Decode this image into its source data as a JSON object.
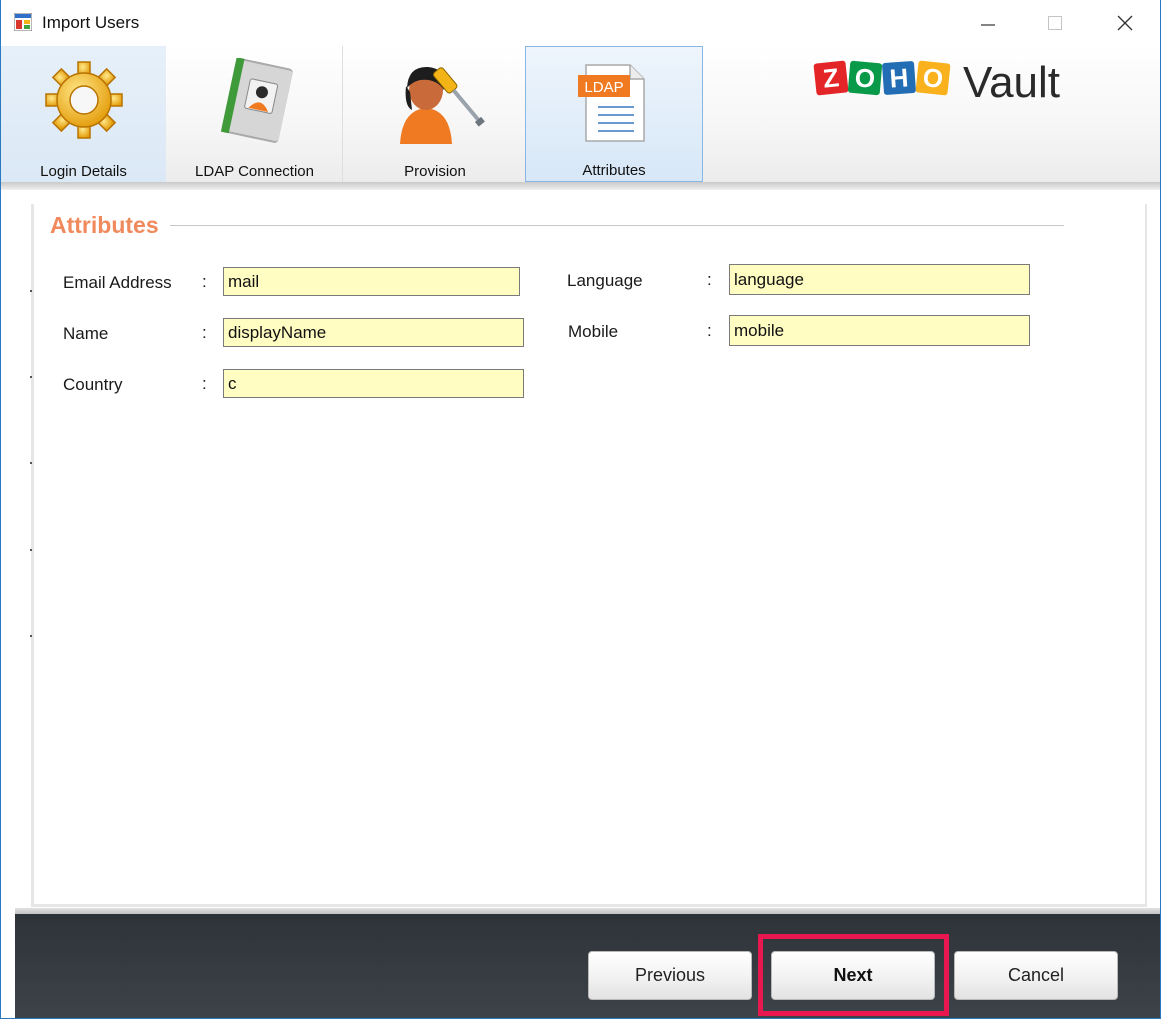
{
  "window": {
    "title": "Import Users",
    "icons": {
      "app": "app-window-icon",
      "minimize": "minimize-icon",
      "maximize": "maximize-icon",
      "close": "close-icon"
    }
  },
  "toolbar": {
    "tabs": [
      {
        "label": "Login Details",
        "icon": "gear-icon"
      },
      {
        "label": "LDAP Connection",
        "icon": "address-book-icon"
      },
      {
        "label": "Provision",
        "icon": "user-tools-icon"
      },
      {
        "label": "Attributes",
        "icon": "ldap-document-icon",
        "badge": "LDAP"
      }
    ],
    "active_tab": "Attributes",
    "logo": {
      "letters": [
        "Z",
        "O",
        "H",
        "O"
      ],
      "colors": [
        "#e42527",
        "#089949",
        "#226db4",
        "#f9b21d"
      ],
      "product": "Vault"
    }
  },
  "attributes": {
    "section_title": "Attributes",
    "fields": [
      {
        "label": "Email Address",
        "value": "mail"
      },
      {
        "label": "Name",
        "value": "displayName"
      },
      {
        "label": "Country",
        "value": "c"
      },
      {
        "label": "Language",
        "value": "language"
      },
      {
        "label": "Mobile",
        "value": "mobile"
      }
    ],
    "separator": ":"
  },
  "footer": {
    "previous_label": "Previous",
    "next_label": "Next",
    "cancel_label": "Cancel",
    "highlight_color": "#e8174f"
  }
}
